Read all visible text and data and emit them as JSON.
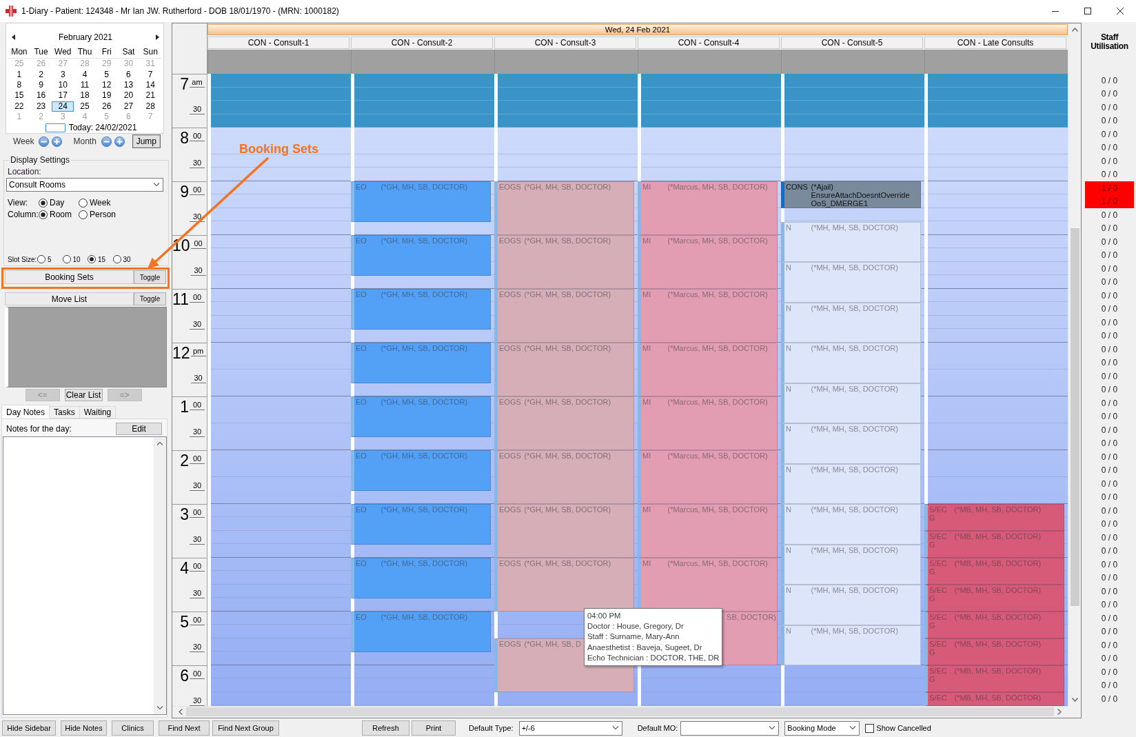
{
  "window": {
    "title": "1-Diary - Patient: 124348 - Mr Ian JW. Rutherford - DOB 18/01/1970 - (MRN: 1000182)"
  },
  "calendar": {
    "month": "February 2021",
    "weekdays": [
      "Mon",
      "Tue",
      "Wed",
      "Thu",
      "Fri",
      "Sat",
      "Sun"
    ],
    "weeks": [
      [
        {
          "day": "25",
          "in_month": false,
          "selected": false
        },
        {
          "day": "26",
          "in_month": false,
          "selected": false
        },
        {
          "day": "27",
          "in_month": false,
          "selected": false
        },
        {
          "day": "28",
          "in_month": false,
          "selected": false
        },
        {
          "day": "29",
          "in_month": false,
          "selected": false
        },
        {
          "day": "30",
          "in_month": false,
          "selected": false
        },
        {
          "day": "31",
          "in_month": false,
          "selected": false
        }
      ],
      [
        {
          "day": "1",
          "in_month": true,
          "selected": false
        },
        {
          "day": "2",
          "in_month": true,
          "selected": false
        },
        {
          "day": "3",
          "in_month": true,
          "selected": false
        },
        {
          "day": "4",
          "in_month": true,
          "selected": false
        },
        {
          "day": "5",
          "in_month": true,
          "selected": false
        },
        {
          "day": "6",
          "in_month": true,
          "selected": false
        },
        {
          "day": "7",
          "in_month": true,
          "selected": false
        }
      ],
      [
        {
          "day": "8",
          "in_month": true,
          "selected": false
        },
        {
          "day": "9",
          "in_month": true,
          "selected": false
        },
        {
          "day": "10",
          "in_month": true,
          "selected": false
        },
        {
          "day": "11",
          "in_month": true,
          "selected": false
        },
        {
          "day": "12",
          "in_month": true,
          "selected": false
        },
        {
          "day": "13",
          "in_month": true,
          "selected": false
        },
        {
          "day": "14",
          "in_month": true,
          "selected": false
        }
      ],
      [
        {
          "day": "15",
          "in_month": true,
          "selected": false
        },
        {
          "day": "16",
          "in_month": true,
          "selected": false
        },
        {
          "day": "17",
          "in_month": true,
          "selected": false
        },
        {
          "day": "18",
          "in_month": true,
          "selected": false
        },
        {
          "day": "19",
          "in_month": true,
          "selected": false
        },
        {
          "day": "20",
          "in_month": true,
          "selected": false
        },
        {
          "day": "21",
          "in_month": true,
          "selected": false
        }
      ],
      [
        {
          "day": "22",
          "in_month": true,
          "selected": false
        },
        {
          "day": "23",
          "in_month": true,
          "selected": false
        },
        {
          "day": "24",
          "in_month": true,
          "selected": true
        },
        {
          "day": "25",
          "in_month": true,
          "selected": false
        },
        {
          "day": "26",
          "in_month": true,
          "selected": false
        },
        {
          "day": "27",
          "in_month": true,
          "selected": false
        },
        {
          "day": "28",
          "in_month": true,
          "selected": false
        }
      ],
      [
        {
          "day": "1",
          "in_month": false,
          "selected": false
        },
        {
          "day": "2",
          "in_month": false,
          "selected": false
        },
        {
          "day": "3",
          "in_month": false,
          "selected": false
        },
        {
          "day": "4",
          "in_month": false,
          "selected": false
        },
        {
          "day": "5",
          "in_month": false,
          "selected": false
        },
        {
          "day": "6",
          "in_month": false,
          "selected": false
        },
        {
          "day": "7",
          "in_month": false,
          "selected": false
        }
      ]
    ],
    "today": "Today: 24/02/2021"
  },
  "navigation": {
    "week": "Week",
    "month": "Month",
    "jump": "Jump"
  },
  "display_settings": {
    "title": "Display Settings",
    "location_label": "Location:",
    "location": "Consult Rooms",
    "view_label": "View:",
    "view_options": [
      {
        "label": "Day",
        "selected": true
      },
      {
        "label": "Week",
        "selected": false
      }
    ],
    "column_label": "Column:",
    "column_options": [
      {
        "label": "Room",
        "selected": true
      },
      {
        "label": "Person",
        "selected": false
      }
    ],
    "slot_size_label": "Slot Size:",
    "slot_sizes": [
      {
        "label": "5",
        "selected": false
      },
      {
        "label": "10",
        "selected": false
      },
      {
        "label": "15",
        "selected": true
      },
      {
        "label": "30",
        "selected": false
      }
    ]
  },
  "booking_sets": {
    "title": "Booking Sets",
    "toggle": "Toggle"
  },
  "move_list": {
    "title": "Move List",
    "toggle": "Toggle",
    "buttons": [
      {
        "label": "<=",
        "disabled": true
      },
      {
        "label": "Clear List",
        "disabled": false
      },
      {
        "label": "=>",
        "disabled": true
      }
    ]
  },
  "notes": {
    "tabs": [
      {
        "label": "Day Notes",
        "selected": true
      },
      {
        "label": "Tasks",
        "selected": false
      },
      {
        "label": "Waiting",
        "selected": false
      }
    ],
    "label": "Notes for the day:",
    "edit": "Edit"
  },
  "diary": {
    "date": "Wed, 24 Feb 2021",
    "hours": [
      {
        "label": "7",
        "suffix": "am",
        "half": "30",
        "kind": "closed"
      },
      {
        "label": "8",
        "suffix": "00",
        "half": "30",
        "kind": "open"
      },
      {
        "label": "9",
        "suffix": "00",
        "half": "30",
        "kind": "open"
      },
      {
        "label": "10",
        "suffix": "00",
        "half": "30",
        "kind": "open"
      },
      {
        "label": "11",
        "suffix": "00",
        "half": "30",
        "kind": "open"
      },
      {
        "label": "12",
        "suffix": "pm",
        "half": "30",
        "kind": "open"
      },
      {
        "label": "1",
        "suffix": "00",
        "half": "30",
        "kind": "open"
      },
      {
        "label": "2",
        "suffix": "00",
        "half": "30",
        "kind": "open"
      },
      {
        "label": "3",
        "suffix": "00",
        "half": "30",
        "kind": "open"
      },
      {
        "label": "4",
        "suffix": "00",
        "half": "30",
        "kind": "open"
      },
      {
        "label": "5",
        "suffix": "00",
        "half": "30",
        "kind": "open"
      },
      {
        "label": "6",
        "suffix": "00",
        "half": "30",
        "kind": "open"
      }
    ],
    "columns": [
      {
        "title": "CON - Consult-1"
      },
      {
        "title": "CON - Consult-2",
        "entries": [
          {
            "kind": "hour"
          },
          {
            "kind": "hour"
          },
          {
            "kind": "threequarter",
            "code": "EO",
            "staff": "(*GH, MH, SB, DOCTOR)",
            "color": "#52a1f7",
            "booked": false
          },
          {
            "kind": "quarter"
          },
          {
            "kind": "threequarter",
            "code": "EO",
            "staff": "(*GH, MH, SB, DOCTOR)",
            "color": "#52a1f7",
            "booked": false
          },
          {
            "kind": "quarter"
          },
          {
            "kind": "threequarter",
            "code": "EO",
            "staff": "(*GH, MH, SB, DOCTOR)",
            "color": "#52a1f7",
            "booked": false
          },
          {
            "kind": "quarter"
          },
          {
            "kind": "threequarter",
            "code": "EO",
            "staff": "(*GH, MH, SB, DOCTOR)",
            "color": "#52a1f7",
            "booked": false
          },
          {
            "kind": "quarter"
          },
          {
            "kind": "threequarter",
            "code": "EO",
            "staff": "(*GH, MH, SB, DOCTOR)",
            "color": "#52a1f7",
            "booked": false
          },
          {
            "kind": "quarter"
          },
          {
            "kind": "threequarter",
            "code": "EO",
            "staff": "(*GH, MH, SB, DOCTOR)",
            "color": "#52a1f7",
            "booked": false
          },
          {
            "kind": "quarter"
          },
          {
            "kind": "threequarter",
            "code": "EO",
            "staff": "(*GH, MH, SB, DOCTOR)",
            "color": "#52a1f7",
            "booked": false
          },
          {
            "kind": "quarter"
          },
          {
            "kind": "threequarter",
            "code": "EO",
            "staff": "(*GH, MH, SB, DOCTOR)",
            "color": "#52a1f7",
            "booked": false
          },
          {
            "kind": "quarter"
          },
          {
            "kind": "threequarter",
            "code": "EO",
            "staff": "(*GH, MH, SB, DOCTOR)",
            "color": "#52a1f7",
            "booked": false
          }
        ]
      },
      {
        "title": "CON - Consult-3",
        "entries": [
          {
            "kind": "hour"
          },
          {
            "kind": "hour"
          },
          {
            "kind": "hour",
            "code": "EOGS",
            "staff": "(*GH, MH, SB, DOCTOR)",
            "color": "#d6aeb8",
            "booked": false
          },
          {
            "kind": "hour",
            "code": "EOGS",
            "staff": "(*GH, MH, SB, DOCTOR)",
            "color": "#d6aeb8",
            "booked": false
          },
          {
            "kind": "hour",
            "code": "EOGS",
            "staff": "(*GH, MH, SB, DOCTOR)",
            "color": "#d6aeb8",
            "booked": false
          },
          {
            "kind": "hour",
            "code": "EOGS",
            "staff": "(*GH, MH, SB, DOCTOR)",
            "color": "#d6aeb8",
            "booked": false
          },
          {
            "kind": "hour",
            "code": "EOGS",
            "staff": "(*GH, MH, SB, DOCTOR)",
            "color": "#d6aeb8",
            "booked": false
          },
          {
            "kind": "hour",
            "code": "EOGS",
            "staff": "(*GH, MH, SB, DOCTOR)",
            "color": "#d6aeb8",
            "booked": false
          },
          {
            "kind": "hour",
            "code": "EOGS",
            "staff": "(*GH, MH, SB, DOCTOR)",
            "color": "#d6aeb8",
            "booked": false
          },
          {
            "kind": "hour",
            "code": "EOGS",
            "staff": "(*GH, MH, SB, DOCTOR)",
            "color": "#d6aeb8",
            "booked": false
          },
          {
            "kind": "half"
          },
          {
            "kind": "hour",
            "code": "EOGS",
            "staff": "(*GH, MH, SB, D",
            "color": "#d6aeb8",
            "booked": false
          }
        ]
      },
      {
        "title": "CON - Consult-4",
        "entries": [
          {
            "kind": "hour"
          },
          {
            "kind": "hour"
          },
          {
            "kind": "hour",
            "code": "MI",
            "staff": "(*Marcus, MH, SB, DOCTOR)",
            "color": "#e29db3",
            "booked": false
          },
          {
            "kind": "hour",
            "code": "MI",
            "staff": "(*Marcus, MH, SB, DOCTOR)",
            "color": "#e29db3",
            "booked": false
          },
          {
            "kind": "hour",
            "code": "MI",
            "staff": "(*Marcus, MH, SB, DOCTOR)",
            "color": "#e29db3",
            "booked": false
          },
          {
            "kind": "hour",
            "code": "MI",
            "staff": "(*Marcus, MH, SB, DOCTOR)",
            "color": "#e29db3",
            "booked": false
          },
          {
            "kind": "hour",
            "code": "MI",
            "staff": "(*Marcus, MH, SB, DOCTOR)",
            "color": "#e29db3",
            "booked": false
          },
          {
            "kind": "hour",
            "code": "MI",
            "staff": "(*Marcus, MH, SB, DOCTOR)",
            "color": "#e29db3",
            "booked": false
          },
          {
            "kind": "hour",
            "code": "MI",
            "staff": "(*Marcus, MH, SB, DOCTOR)",
            "color": "#e29db3",
            "booked": false
          },
          {
            "kind": "hour",
            "code": "MI",
            "staff": "(*Marcus, MH, SB, DOCTOR)",
            "color": "#e29db3",
            "booked": false
          },
          {
            "kind": "hour",
            "staff": "SB, DOCTOR)",
            "color": "#e29db3",
            "booked": false
          }
        ]
      },
      {
        "title": "CON - Consult-5",
        "entries": [
          {
            "kind": "hour"
          },
          {
            "kind": "hour"
          },
          {
            "kind": "half",
            "code": "CONS",
            "staff": "(*Ajail)",
            "notes": [
              "EnsureAttachDoesntOverride",
              "OoS_DMERGE1"
            ],
            "color": "#788a9c",
            "booked": true
          },
          {
            "kind": "quarter"
          },
          {
            "kind": "threequarter",
            "code": "N",
            "staff": "(*MH, MH, SB, DOCTOR)",
            "color": "#dde5fb",
            "booked": false
          },
          {
            "kind": "threequarter",
            "code": "N",
            "staff": "(*MH, MH, SB, DOCTOR)",
            "color": "#dde5fb",
            "booked": false
          },
          {
            "kind": "threequarter",
            "code": "N",
            "staff": "(*MH, MH, SB, DOCTOR)",
            "color": "#dde5fb",
            "booked": false
          },
          {
            "kind": "threequarter",
            "code": "N",
            "staff": "(*MH, MH, SB, DOCTOR)",
            "color": "#dde5fb",
            "booked": false
          },
          {
            "kind": "threequarter",
            "code": "N",
            "staff": "(*MH, MH, SB, DOCTOR)",
            "color": "#dde5fb",
            "booked": false
          },
          {
            "kind": "threequarter",
            "code": "N",
            "staff": "(*MH, MH, SB, DOCTOR)",
            "color": "#dde5fb",
            "booked": false
          },
          {
            "kind": "threequarter",
            "code": "N",
            "staff": "(*MH, MH, SB, DOCTOR)",
            "color": "#dde5fb",
            "booked": false
          },
          {
            "kind": "threequarter",
            "code": "N",
            "staff": "(*MH, MH, SB, DOCTOR)",
            "color": "#dde5fb",
            "booked": false
          },
          {
            "kind": "threequarter",
            "code": "N",
            "staff": "(*MH, MH, SB, DOCTOR)",
            "color": "#dde5fb",
            "booked": false
          },
          {
            "kind": "threequarter",
            "code": "N",
            "staff": "(*MH, MH, SB, DOCTOR)",
            "color": "#dde5fb",
            "booked": false
          },
          {
            "kind": "threequarter",
            "code": "N",
            "staff": "(*MH, MH, SB, DOCTOR)",
            "color": "#dde5fb",
            "booked": false
          }
        ]
      },
      {
        "title": "CON - Late Consults",
        "entries": [
          {
            "kind": "hour"
          },
          {
            "kind": "hour"
          },
          {
            "kind": "hour"
          },
          {
            "kind": "hour"
          },
          {
            "kind": "hour"
          },
          {
            "kind": "hour"
          },
          {
            "kind": "hour"
          },
          {
            "kind": "hour"
          },
          {
            "kind": "half",
            "code": "S/ECG",
            "staff": "(*MB, MH, SB, DOCTOR)",
            "color": "#d75a78",
            "booked": false
          },
          {
            "kind": "half",
            "code": "S/ECG",
            "staff": "(*MB, MH, SB, DOCTOR)",
            "color": "#d75a78",
            "booked": false
          },
          {
            "kind": "half",
            "code": "S/ECG",
            "staff": "(*MB, MH, SB, DOCTOR)",
            "color": "#d75a78",
            "booked": false
          },
          {
            "kind": "half",
            "code": "S/ECG",
            "staff": "(*MB, MH, SB, DOCTOR)",
            "color": "#d75a78",
            "booked": false
          },
          {
            "kind": "half",
            "code": "S/ECG",
            "staff": "(*MB, MH, SB, DOCTOR)",
            "color": "#d75a78",
            "booked": false
          },
          {
            "kind": "half",
            "code": "S/ECG",
            "staff": "(*MB, MH, SB, DOCTOR)",
            "color": "#d75a78",
            "booked": false
          },
          {
            "kind": "half",
            "code": "S/ECG",
            "staff": "(*MB, MH, SB, DOCTOR)",
            "color": "#d75a78",
            "booked": false
          },
          {
            "kind": "quarter",
            "code": "S/EC",
            "staff": "(*MB, MH, SB, DOCTOR)",
            "color": "#d75a78",
            "booked": false
          }
        ]
      }
    ]
  },
  "tooltip": {
    "lines": [
      "04:00 PM",
      "Doctor : House, Gregory, Dr",
      "Staff : Surname, Mary-Ann",
      "Anaesthetist : Baveja, Sugeet, Dr",
      "Echo Technician : DOCTOR, THE, DR"
    ]
  },
  "staff_utilisation": {
    "title": "Staff Utilisation",
    "slots": [
      {
        "value": "0 / 0",
        "over": false
      },
      {
        "value": "0 / 0",
        "over": false
      },
      {
        "value": "0 / 0",
        "over": false
      },
      {
        "value": "0 / 0",
        "over": false
      },
      {
        "value": "0 / 0",
        "over": false
      },
      {
        "value": "0 / 0",
        "over": false
      },
      {
        "value": "0 / 0",
        "over": false
      },
      {
        "value": "0 / 0",
        "over": false
      },
      {
        "value": "1 / 0",
        "over": true
      },
      {
        "value": "1 / 0",
        "over": true
      },
      {
        "value": "0 / 0",
        "over": false
      },
      {
        "value": "0 / 0",
        "over": false
      },
      {
        "value": "0 / 0",
        "over": false
      },
      {
        "value": "0 / 0",
        "over": false
      },
      {
        "value": "0 / 0",
        "over": false
      },
      {
        "value": "0 / 0",
        "over": false
      },
      {
        "value": "0 / 0",
        "over": false
      },
      {
        "value": "0 / 0",
        "over": false
      },
      {
        "value": "0 / 0",
        "over": false
      },
      {
        "value": "0 / 0",
        "over": false
      },
      {
        "value": "0 / 0",
        "over": false
      },
      {
        "value": "0 / 0",
        "over": false
      },
      {
        "value": "0 / 0",
        "over": false
      },
      {
        "value": "0 / 0",
        "over": false
      },
      {
        "value": "0 / 0",
        "over": false
      },
      {
        "value": "0 / 0",
        "over": false
      },
      {
        "value": "0 / 0",
        "over": false
      },
      {
        "value": "0 / 0",
        "over": false
      },
      {
        "value": "0 / 0",
        "over": false
      },
      {
        "value": "0 / 0",
        "over": false
      },
      {
        "value": "0 / 0",
        "over": false
      },
      {
        "value": "0 / 0",
        "over": false
      },
      {
        "value": "0 / 0",
        "over": false
      },
      {
        "value": "0 / 0",
        "over": false
      },
      {
        "value": "0 / 0",
        "over": false
      },
      {
        "value": "0 / 0",
        "over": false
      },
      {
        "value": "0 / 0",
        "over": false
      },
      {
        "value": "0 / 0",
        "over": false
      },
      {
        "value": "0 / 0",
        "over": false
      },
      {
        "value": "0 / 0",
        "over": false
      },
      {
        "value": "0 / 0",
        "over": false
      },
      {
        "value": "0 / 0",
        "over": false
      },
      {
        "value": "0 / 0",
        "over": false
      },
      {
        "value": "0 / 0",
        "over": false
      },
      {
        "value": "0 / 0",
        "over": false
      },
      {
        "value": "0 / 0",
        "over": false
      },
      {
        "value": "0 / 0",
        "over": false
      }
    ]
  },
  "toolbar": {
    "buttons": [
      "Hide Sidebar",
      "Hide Notes",
      "Clinics",
      "Find Next",
      "Find Next Group"
    ],
    "actions": [
      "Refresh",
      "Print"
    ],
    "default_type_label": "Default Type:",
    "default_type": "+/-6",
    "default_mo_label": "Default MO:",
    "mode": "Booking Mode",
    "show_cancelled": {
      "label": "Show Cancelled",
      "checked": false
    }
  },
  "annotation": {
    "label": "Booking Sets"
  }
}
